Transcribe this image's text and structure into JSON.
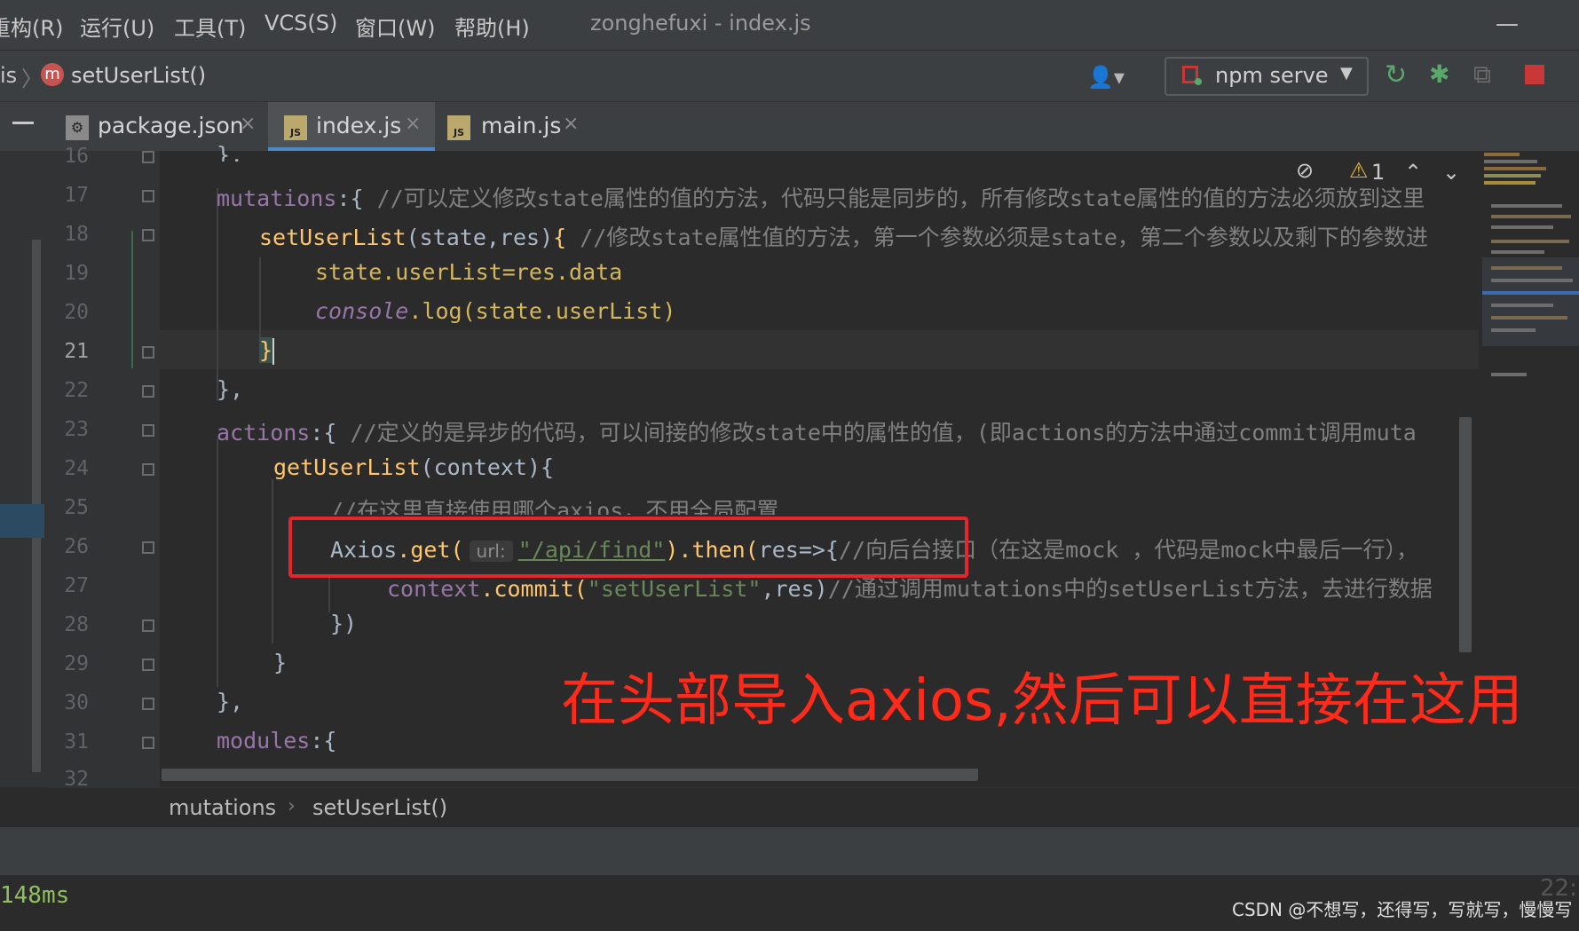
{
  "menubar": {
    "items": [
      "重构(R)",
      "运行(U)",
      "工具(T)",
      "VCS(S)",
      "窗口(W)",
      "帮助(H)"
    ],
    "window_title": "zonghefuxi - index.js"
  },
  "navbar": {
    "crumb_fragment": "is",
    "method_badge": "m",
    "method_label": "setUserList()",
    "run_config": "npm serve"
  },
  "tabs": [
    {
      "label": "package.json",
      "icon": "package-json-icon",
      "active": false
    },
    {
      "label": "index.js",
      "icon": "js-file-icon",
      "active": true
    },
    {
      "label": "main.js",
      "icon": "js-file-icon",
      "active": false
    }
  ],
  "tab_close": "×",
  "js_icon_text": "JS",
  "inspection": {
    "warning_count": "1"
  },
  "line_numbers": [
    "16",
    "17",
    "18",
    "19",
    "20",
    "21",
    "22",
    "23",
    "24",
    "25",
    "26",
    "27",
    "28",
    "29",
    "30",
    "31",
    "32"
  ],
  "current_line": "21",
  "code": {
    "l16": "},",
    "l17_key": "mutations",
    "l17_rest": ":{ ",
    "l17_comment": "//可以定义修改state属性的值的方法，代码只能是同步的，所有修改state属性的值的方法必须放到这里",
    "l18_fn": "setUserList",
    "l18_args": "(state,res)",
    "l18_brace": "{ ",
    "l18_comment": "//修改state属性值的方法，第一个参数必须是state，第二个参数以及剩下的参数进",
    "l19": "state.userList=res.data",
    "l20_obj": "console",
    "l20_rest": ".log(state.userList)",
    "l21": "}",
    "l22": "},",
    "l23_key": "actions",
    "l23_rest": ":{ ",
    "l23_comment": "//定义的是异步的代码，可以间接的修改state中的属性的值，(即actions的方法中通过commit调用muta",
    "l24_fn": "getUserList",
    "l24_args": "(context){",
    "l25_comment": "//在这里直接使用哪个axios，不用全局配置",
    "l26_obj": "Axios",
    "l26_get": ".get(",
    "l26_hint": "url:",
    "l26_str": "\"/api/find\"",
    "l26_then": ").then(",
    "l26_res": "res=>{",
    "l26_comment": "//向后台接口（在这是mock ，代码是mock中最后一行），",
    "l27_obj": "context",
    "l27_call": ".commit(",
    "l27_str": "\"setUserList\"",
    "l27_rest": ",res)",
    "l27_comment": "//通过调用mutations中的setUserList方法，去进行数据",
    "l28": "})",
    "l29": "}",
    "l30": "},",
    "l31_key": "modules",
    "l31_rest": ":{"
  },
  "bottom_breadcrumbs": [
    "mutations",
    "setUserList()"
  ],
  "console": {
    "text": "148ms",
    "right_text": "22:"
  },
  "watermark": "CSDN @不想写，还得写，写就写，慢慢写",
  "annotation": {
    "caption": "在头部导入axios,然后可以直接在这用",
    "color": "#ff2a1a"
  },
  "colors": {
    "keyword": "#cc7832",
    "function": "#ffc66d",
    "property": "#9876aa",
    "comment": "#808080",
    "string": "#6a8759",
    "accent": "#4a88c7"
  }
}
